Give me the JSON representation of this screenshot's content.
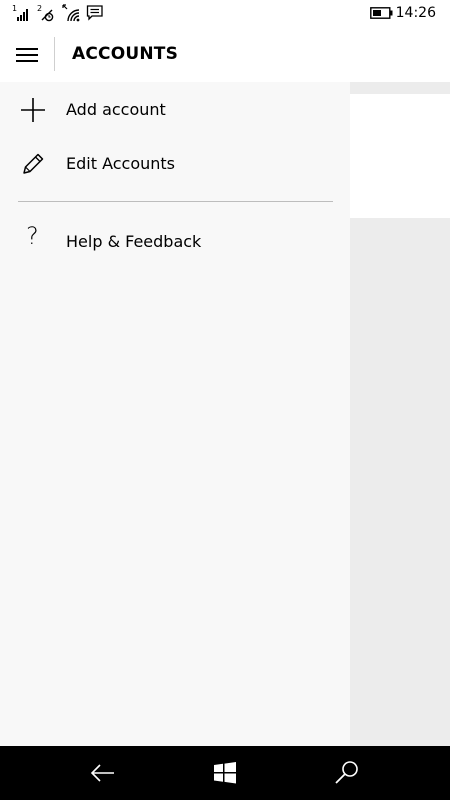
{
  "status_bar": {
    "time": "14:26",
    "icons": [
      "signal-sim1-icon",
      "signal-sim2-icon",
      "wifi-icon",
      "message-icon",
      "battery-icon"
    ],
    "sim1_label": "1",
    "sim2_label": "2"
  },
  "header": {
    "title": "ACCOUNTS",
    "menu_icon": "hamburger-icon"
  },
  "nav": {
    "items": [
      {
        "label": "Add account",
        "icon": "plus-icon"
      },
      {
        "label": "Edit Accounts",
        "icon": "pencil-icon"
      }
    ],
    "footer_items": [
      {
        "label": "Help & Feedback",
        "icon": "question-icon",
        "glyph": "?"
      }
    ]
  },
  "system_nav": {
    "buttons": [
      "back-icon",
      "windows-start-icon",
      "search-icon"
    ]
  },
  "colors": {
    "nav_pane_bg": "#f8f8f8",
    "content_bg": "#ececec",
    "system_bar_bg": "#000000"
  }
}
